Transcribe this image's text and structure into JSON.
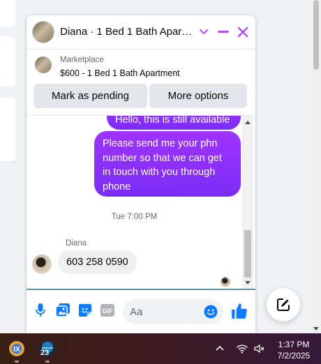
{
  "chat": {
    "title": "Diana · 1 Bed 1 Bath Apart...",
    "listing": {
      "source": "Marketplace",
      "title": "$600 - 1 Bed 1 Bath Apartment"
    },
    "actions": {
      "mark_pending": "Mark as pending",
      "more_options": "More options"
    },
    "messages": [
      {
        "direction": "outgoing",
        "text": "Hello, this is still available"
      },
      {
        "direction": "outgoing",
        "text": "Please send me your phn number so that we can get in touch with you through phone"
      }
    ],
    "timestamp": "Tue 7:00 PM",
    "incoming": {
      "sender": "Diana",
      "text": "603 258 0590"
    },
    "composer": {
      "placeholder": "Aa"
    }
  },
  "colors": {
    "accent": "#a033ff",
    "messenger_purple": "#b14cff",
    "like_blue": "#0a7cff"
  },
  "taskbar": {
    "badge": "23",
    "time": "1:37 PM",
    "date": "7/2/2025"
  }
}
